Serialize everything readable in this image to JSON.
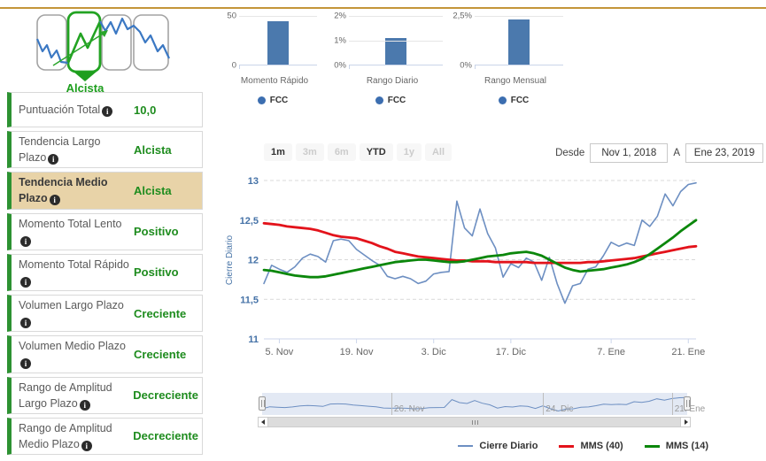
{
  "icons": {
    "info_glyph": "i"
  },
  "trend_icon": {
    "label": "Alcista",
    "active_panel": 2,
    "panel_count": 4,
    "line_color_blue": "#3b78c3",
    "line_color_green": "#22a322"
  },
  "indicators": {
    "rows": [
      {
        "label": "Puntuación Total",
        "value": "10,0",
        "highlighted": false
      },
      {
        "label": "Tendencia Largo Plazo",
        "value": "Alcista",
        "highlighted": false
      },
      {
        "label": "Tendencia Medio Plazo",
        "value": "Alcista",
        "highlighted": true
      },
      {
        "label": "Momento Total Lento",
        "value": "Positivo",
        "highlighted": false
      },
      {
        "label": "Momento Total Rápido",
        "value": "Positivo",
        "highlighted": false
      },
      {
        "label": "Volumen Largo Plazo",
        "value": "Creciente",
        "highlighted": false
      },
      {
        "label": "Volumen Medio Plazo",
        "value": "Creciente",
        "highlighted": false
      },
      {
        "label": "Rango de Amplitud Largo Plazo",
        "value": "Decreciente",
        "highlighted": false
      },
      {
        "label": "Rango de Amplitud Medio Plazo",
        "value": "Decreciente",
        "highlighted": false
      }
    ]
  },
  "range_selector": {
    "buttons": [
      {
        "label": "1m",
        "enabled": true
      },
      {
        "label": "3m",
        "enabled": false
      },
      {
        "label": "6m",
        "enabled": false
      },
      {
        "label": "YTD",
        "enabled": true
      },
      {
        "label": "1y",
        "enabled": false
      },
      {
        "label": "All",
        "enabled": false
      }
    ],
    "from_label": "Desde",
    "from_value": "Nov 1, 2018",
    "to_label": "A",
    "to_value": "Ene 23, 2019"
  },
  "navigator": {
    "ticks": [
      {
        "label": "26. Nov",
        "frac": 0.304
      },
      {
        "label": "24. Dic",
        "frac": 0.661
      },
      {
        "label": "21. Ene",
        "frac": 0.964
      }
    ]
  },
  "chart_data": [
    {
      "type": "bar",
      "title": "Momento Rápido",
      "categories": [
        "FCC"
      ],
      "values": [
        44
      ],
      "ylim": [
        0,
        50
      ],
      "yticks": [
        {
          "label": "50",
          "value": 50
        },
        {
          "label": "0",
          "value": 0
        }
      ],
      "legend": [
        "FCC"
      ],
      "bar_color": "#4b79ad",
      "legend_position": "bottom"
    },
    {
      "type": "bar",
      "title": "Rango Diario",
      "categories": [
        "FCC"
      ],
      "values": [
        1.07
      ],
      "ylim": [
        0,
        2
      ],
      "yticks": [
        {
          "label": "2%",
          "value": 2
        },
        {
          "label": "1%",
          "value": 1
        },
        {
          "label": "0%",
          "value": 0
        }
      ],
      "legend": [
        "FCC"
      ],
      "bar_color": "#4b79ad",
      "legend_position": "bottom"
    },
    {
      "type": "bar",
      "title": "Rango Mensual",
      "categories": [
        "FCC"
      ],
      "values": [
        2.28
      ],
      "ylim": [
        0,
        2.5
      ],
      "yticks": [
        {
          "label": "2,5%",
          "value": 2.5
        },
        {
          "label": "0%",
          "value": 0
        }
      ],
      "legend": [
        "FCC"
      ],
      "bar_color": "#4b79ad",
      "legend_position": "bottom"
    },
    {
      "type": "line",
      "title": "",
      "ylabel": "Cierre Diario",
      "ylim": [
        11,
        13
      ],
      "grid": "dashed-horizontal",
      "x_range": [
        "Nov 1, 2018",
        "Ene 23, 2019"
      ],
      "legend_position": "bottom-right",
      "yticks": [
        {
          "label": "13",
          "value": 13
        },
        {
          "label": "12,5",
          "value": 12.5
        },
        {
          "label": "12",
          "value": 12
        },
        {
          "label": "11,5",
          "value": 11.5
        },
        {
          "label": "11",
          "value": 11
        }
      ],
      "xticks": [
        {
          "label": "5. Nov",
          "index": 2
        },
        {
          "label": "19. Nov",
          "index": 12
        },
        {
          "label": "3. Dic",
          "index": 22
        },
        {
          "label": "17. Dic",
          "index": 32
        },
        {
          "label": "7. Ene",
          "index": 45
        },
        {
          "label": "21. Ene",
          "index": 55
        }
      ],
      "series": [
        {
          "name": "Cierre Diario",
          "color": "#6d8fc2",
          "width": 1.6,
          "values": [
            11.7,
            11.93,
            11.88,
            11.84,
            11.91,
            12.02,
            12.07,
            12.04,
            11.97,
            12.24,
            12.26,
            12.24,
            12.13,
            12.06,
            11.99,
            11.93,
            11.79,
            11.76,
            11.79,
            11.76,
            11.7,
            11.73,
            11.82,
            11.84,
            11.85,
            12.74,
            12.4,
            12.3,
            12.64,
            12.33,
            12.15,
            11.78,
            11.95,
            11.9,
            12.02,
            11.97,
            11.74,
            12.03,
            11.7,
            11.45,
            11.67,
            11.7,
            11.88,
            11.91,
            12.05,
            12.22,
            12.17,
            12.21,
            12.18,
            12.5,
            12.42,
            12.55,
            12.83,
            12.68,
            12.86,
            12.95,
            12.97
          ]
        },
        {
          "name": "MMS (40)",
          "color": "#e3131b",
          "width": 2.8,
          "values": [
            12.46,
            12.45,
            12.44,
            12.42,
            12.41,
            12.4,
            12.39,
            12.37,
            12.34,
            12.31,
            12.29,
            12.28,
            12.27,
            12.24,
            12.21,
            12.17,
            12.14,
            12.1,
            12.08,
            12.06,
            12.04,
            12.03,
            12.02,
            12.01,
            12.0,
            11.99,
            11.99,
            11.98,
            11.98,
            11.98,
            11.97,
            11.97,
            11.97,
            11.97,
            11.97,
            11.96,
            11.96,
            11.96,
            11.96,
            11.96,
            11.96,
            11.96,
            11.97,
            11.97,
            11.98,
            11.99,
            12.0,
            12.01,
            12.02,
            12.04,
            12.06,
            12.08,
            12.1,
            12.12,
            12.14,
            12.16,
            12.17
          ]
        },
        {
          "name": "MMS (14)",
          "color": "#0b870b",
          "width": 2.8,
          "values": [
            11.87,
            11.86,
            11.84,
            11.82,
            11.8,
            11.79,
            11.78,
            11.78,
            11.79,
            11.81,
            11.83,
            11.85,
            11.87,
            11.89,
            11.91,
            11.93,
            11.95,
            11.97,
            11.98,
            11.99,
            12.0,
            12.0,
            11.99,
            11.98,
            11.97,
            11.97,
            11.98,
            12.0,
            12.02,
            12.04,
            12.05,
            12.06,
            12.08,
            12.09,
            12.1,
            12.08,
            12.05,
            12.0,
            11.95,
            11.9,
            11.87,
            11.85,
            11.86,
            11.87,
            11.88,
            11.9,
            11.92,
            11.94,
            11.97,
            12.01,
            12.07,
            12.14,
            12.21,
            12.28,
            12.36,
            12.43,
            12.5
          ]
        }
      ]
    }
  ]
}
